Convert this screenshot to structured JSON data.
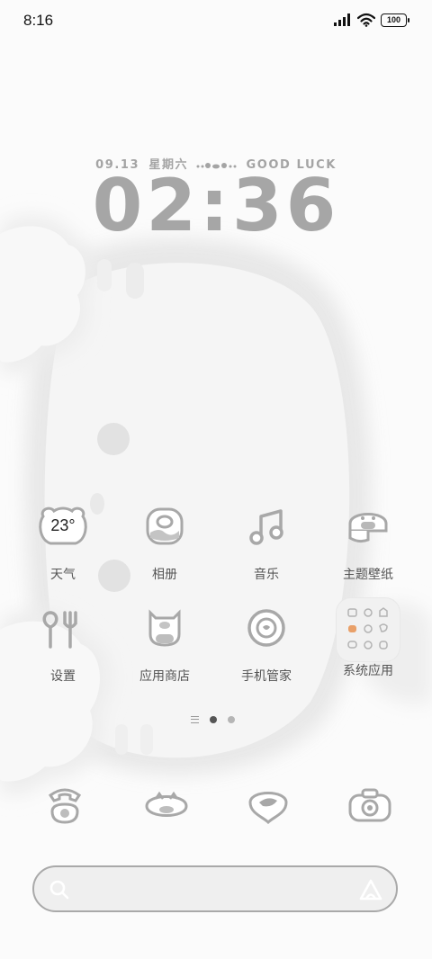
{
  "status_bar": {
    "time": "8:16",
    "battery": "100"
  },
  "clock": {
    "date": "09.13",
    "weekday": "星期六",
    "slogan": "GOOD LUCK",
    "time": "02:36"
  },
  "apps": [
    {
      "label": "天气",
      "badge": "23°",
      "icon": "weather-icon"
    },
    {
      "label": "相册",
      "icon": "gallery-icon"
    },
    {
      "label": "音乐",
      "icon": "music-icon"
    },
    {
      "label": "主题壁纸",
      "icon": "themes-icon"
    },
    {
      "label": "设置",
      "icon": "settings-icon"
    },
    {
      "label": "应用商店",
      "icon": "app-store-icon"
    },
    {
      "label": "手机管家",
      "icon": "security-icon"
    },
    {
      "label": "系统应用",
      "icon": "system-apps-folder-icon"
    }
  ],
  "dock": [
    {
      "icon": "phone-icon"
    },
    {
      "icon": "messages-icon"
    },
    {
      "icon": "browser-icon"
    },
    {
      "icon": "camera-icon"
    }
  ],
  "search": {
    "placeholder": "",
    "value": ""
  },
  "colors": {
    "background": "#fbfbfb",
    "icon_gray": "#a8a8a8",
    "clock_gray": "#a6a6a6"
  }
}
